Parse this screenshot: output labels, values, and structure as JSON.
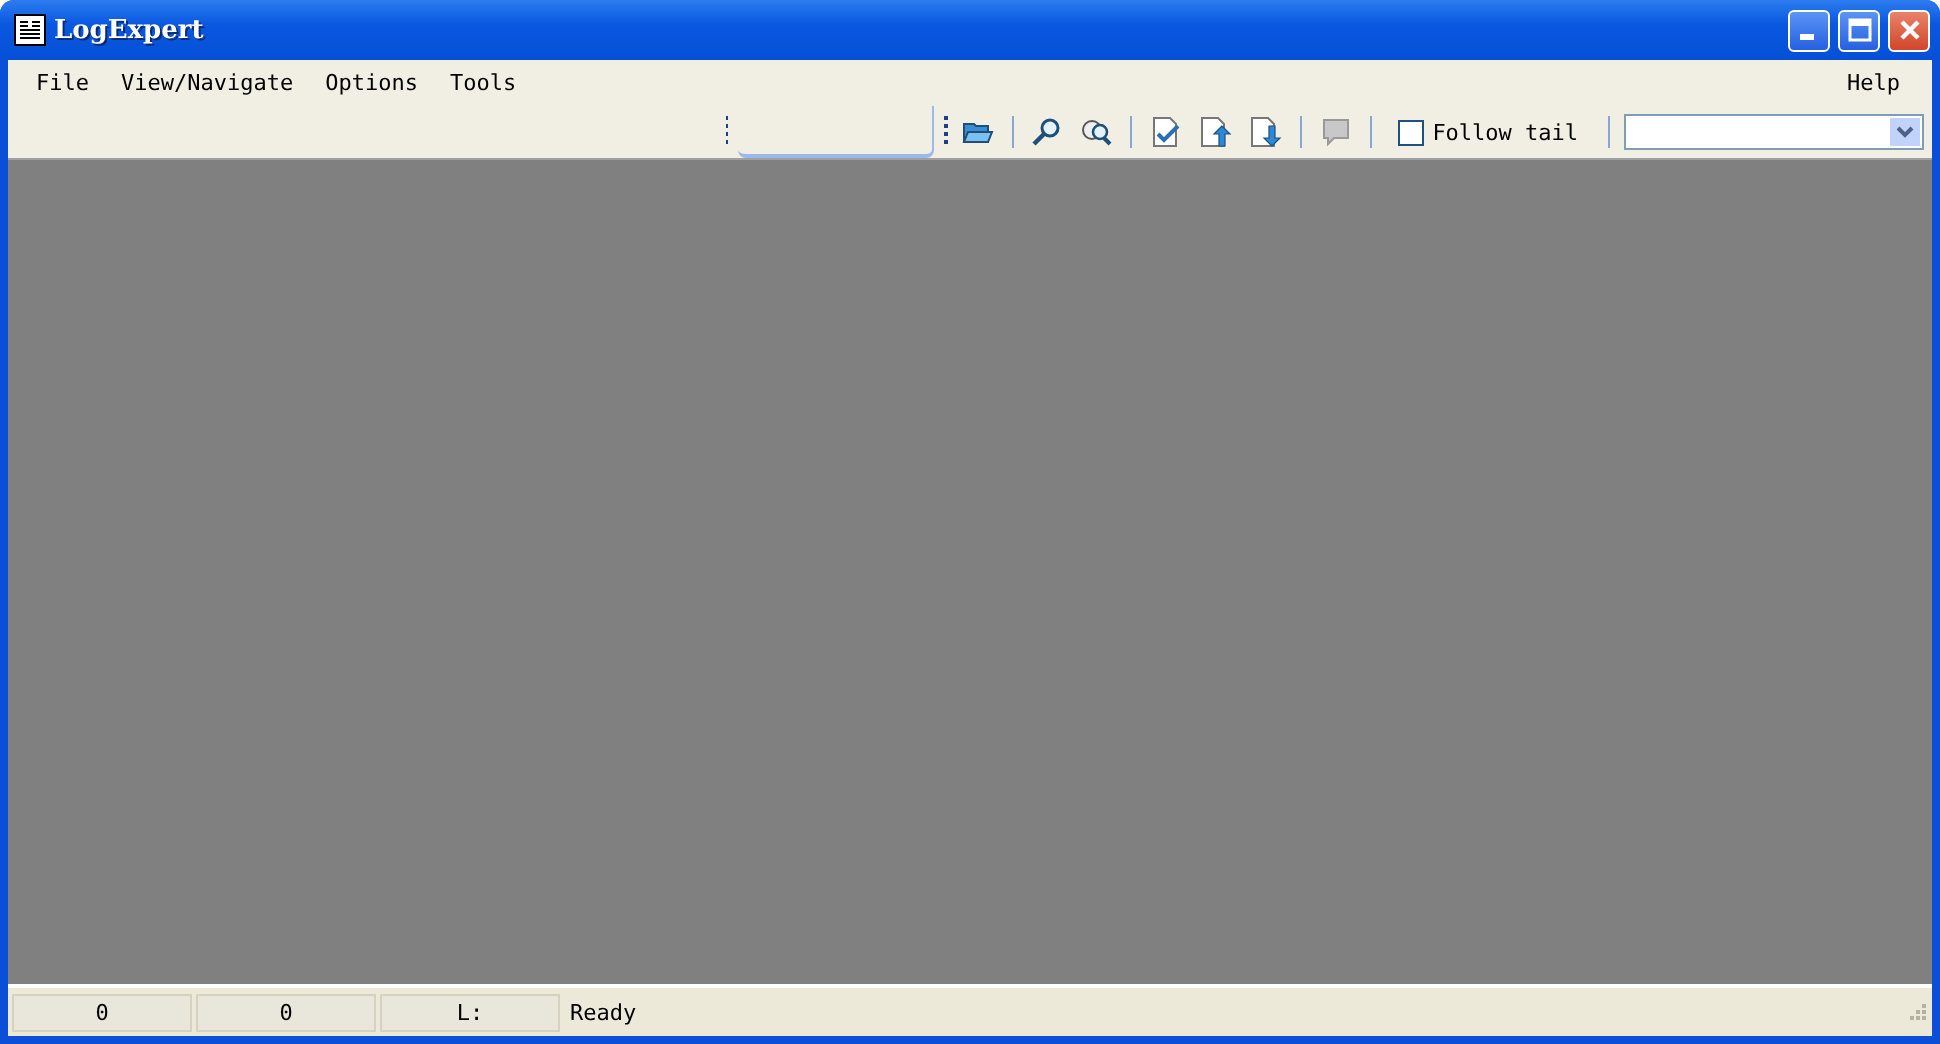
{
  "window": {
    "title": "LogExpert"
  },
  "menu": {
    "items": [
      "File",
      "View/Navigate",
      "Options",
      "Tools"
    ],
    "right_items": [
      "Help"
    ]
  },
  "toolbar": {
    "follow_tail": {
      "label": "Follow tail",
      "checked": false
    }
  },
  "status_bar": {
    "panels": [
      "0",
      "0",
      "L:"
    ],
    "message": "Ready"
  }
}
